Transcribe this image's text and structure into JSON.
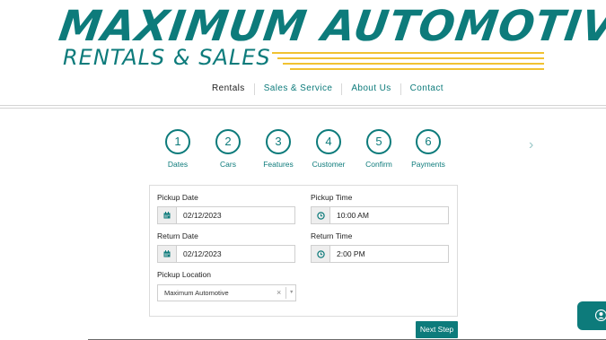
{
  "logo": {
    "line1": "MAXIMUM AUTOMOTIVE",
    "line2": "RENTALS & SALES"
  },
  "colors": {
    "brand_teal": "#0d7b7b",
    "stripe_yellow": "#f1c232"
  },
  "nav": {
    "items": [
      {
        "label": "Rentals",
        "active": true
      },
      {
        "label": "Sales & Service"
      },
      {
        "label": "About Us"
      },
      {
        "label": "Contact"
      }
    ]
  },
  "steps": [
    {
      "number": "1",
      "label": "Dates"
    },
    {
      "number": "2",
      "label": "Cars"
    },
    {
      "number": "3",
      "label": "Features"
    },
    {
      "number": "4",
      "label": "Customer"
    },
    {
      "number": "5",
      "label": "Confirm"
    },
    {
      "number": "6",
      "label": "Payments"
    }
  ],
  "form": {
    "pickup_date": {
      "label": "Pickup Date",
      "value": "02/12/2023",
      "icon": "calendar-icon"
    },
    "pickup_time": {
      "label": "Pickup Time",
      "value": "10:00 AM",
      "icon": "clock-icon"
    },
    "return_date": {
      "label": "Return Date",
      "value": "02/12/2023",
      "icon": "calendar-icon"
    },
    "return_time": {
      "label": "Return Time",
      "value": "2:00 PM",
      "icon": "clock-icon"
    },
    "pickup_location": {
      "label": "Pickup Location",
      "value": "Maximum Automotive",
      "clear": "×",
      "arrow": "▼"
    }
  },
  "buttons": {
    "next_step": "Next Step"
  },
  "icons": {
    "next_arrow": "›"
  }
}
